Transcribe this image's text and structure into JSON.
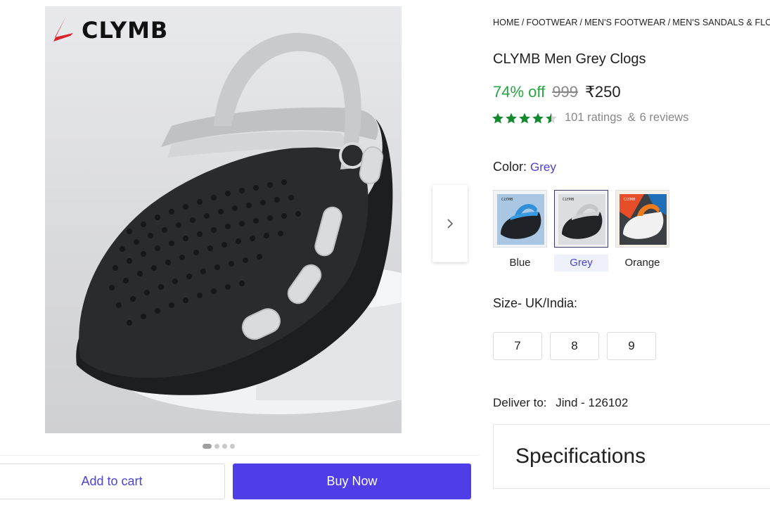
{
  "brand": {
    "logo_text": "CLYMB",
    "accent": "#d8232a"
  },
  "gallery": {
    "image_count": 4,
    "active_index": 0,
    "next_icon": "chevron-right-icon"
  },
  "breadcrumb": {
    "items": [
      "HOME",
      "FOOTWEAR",
      "MEN'S FOOTWEAR",
      "MEN'S SANDALS & FLO"
    ],
    "separator": "/"
  },
  "product": {
    "title": "CLYMB Men Grey Clogs",
    "discount": "74% off",
    "mrp": "999",
    "price": "₹250",
    "rating_value": 4.5,
    "ratings_text": "101 ratings",
    "reviews_amp": "&",
    "reviews_text": "6 reviews",
    "star_color": "#128a2b"
  },
  "color": {
    "label": "Color:",
    "selected": "Grey",
    "options": [
      {
        "label": "Blue"
      },
      {
        "label": "Grey"
      },
      {
        "label": "Orange"
      }
    ]
  },
  "size": {
    "label": "Size- UK/India:",
    "options": [
      "7",
      "8",
      "9"
    ]
  },
  "delivery": {
    "label": "Deliver to:",
    "location": "Jind - 126102"
  },
  "specifications": {
    "title": "Specifications"
  },
  "actions": {
    "add_to_cart": "Add to cart",
    "buy_now": "Buy Now",
    "primary_color": "#4f3ee8"
  }
}
